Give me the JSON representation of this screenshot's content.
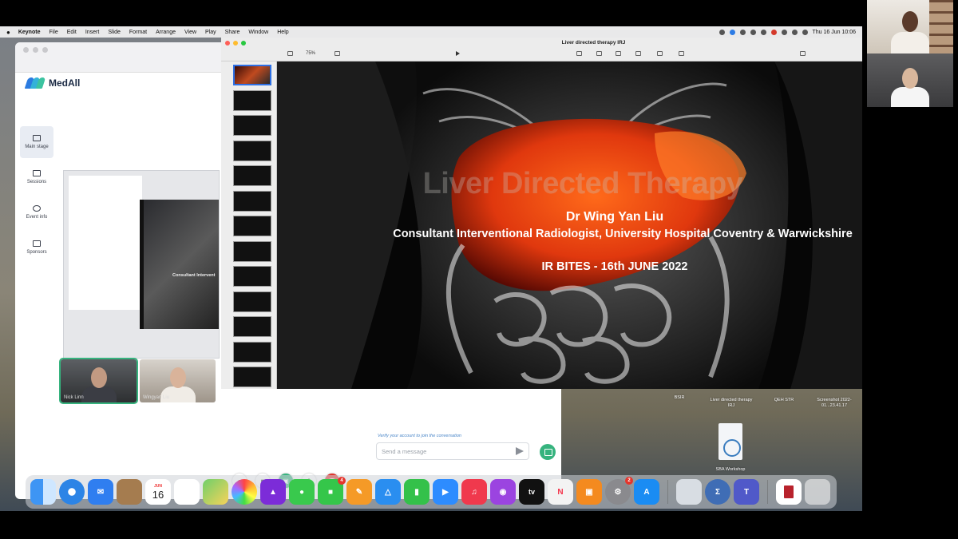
{
  "menubar": {
    "app": "Keynote",
    "items": [
      "File",
      "Edit",
      "Insert",
      "Slide",
      "Format",
      "Arrange",
      "View",
      "Play",
      "Share",
      "Window",
      "Help"
    ],
    "clock": "Thu 16 Jun  10:06"
  },
  "medall": {
    "brand": "MedAll",
    "nav": [
      {
        "label": "Main stage"
      },
      {
        "label": "Sessions"
      },
      {
        "label": "Event info"
      },
      {
        "label": "Sponsors"
      }
    ],
    "stage_slide_text": "Consultant Intervent",
    "participants": [
      {
        "name": "Nick Linn"
      },
      {
        "name": "Wingyan Liu"
      }
    ],
    "chat": {
      "verify_text": "Verify your account to join the conversation",
      "message_placeholder": "Send a message"
    }
  },
  "keynote": {
    "document_title": "Liver directed therapy IRJ",
    "zoom": "75%",
    "slide_count": 13,
    "slide": {
      "title": "Liver Directed Therapy",
      "presenter": "Dr Wing Yan Liu",
      "role": "Consultant Interventional Radiologist, University Hospital Coventry & Warwickshire",
      "event": "IR BITES - 16th JUNE 2022"
    }
  },
  "desktop": {
    "items": [
      {
        "label": "BSIR"
      },
      {
        "label": "Liver directed therapy IRJ"
      },
      {
        "label": "QEH STR"
      },
      {
        "label": "Screenshot 2022-01...23.41.17"
      },
      {
        "label": "SBA Workshop"
      }
    ]
  },
  "dock": {
    "calendar_day": "16",
    "calendar_month": "JUN",
    "facetime_badge": "4",
    "settings_badge": "2",
    "tv_label": "tv",
    "apps": [
      "finder-icon",
      "safari-icon",
      "mail-icon",
      "notes-icon",
      "calendar-icon",
      "reminders-icon",
      "maps-icon",
      "photos-icon",
      "affinity-icon",
      "messages-icon",
      "facetime-icon",
      "pages-icon",
      "keynote-icon",
      "numbers-icon",
      "zoom-icon",
      "music-icon",
      "podcasts-icon",
      "tv-icon",
      "news-icon",
      "books-icon",
      "settings-icon",
      "appstore-icon",
      "preview-icon",
      "sigma-icon",
      "teams-icon",
      "document-icon",
      "trash-icon"
    ]
  },
  "colors": {
    "accent_green": "#36b37e",
    "keynote_select": "#2d6fe4",
    "end_call": "#e0332b"
  }
}
